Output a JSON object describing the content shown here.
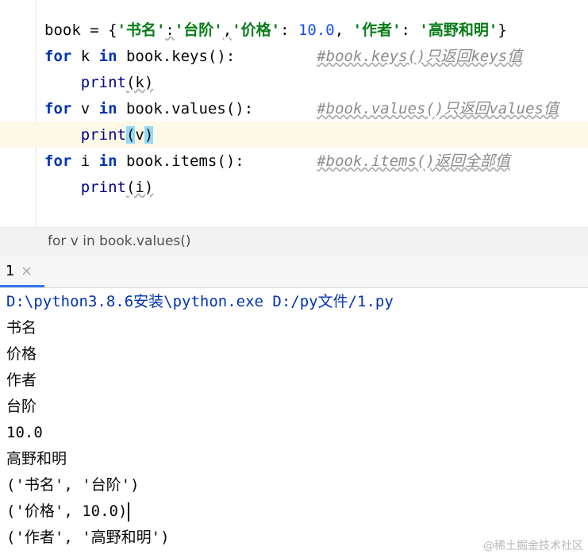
{
  "editor": {
    "line1": {
      "pre": "book = {",
      "k1": "'书名'",
      "sep1": ":",
      "v1": "'台阶'",
      "sep2": ",",
      "k2": "'价格'",
      "sep3": ": ",
      "v2": "10.0",
      "sep4": ", ",
      "k3": "'作者'",
      "sep5": ": ",
      "v3": "'高野和明'",
      "post": "}"
    },
    "line2": {
      "kw1": "for",
      "mid1": " k ",
      "kw2": "in",
      "mid2": " book.keys():         ",
      "comment": "#book.keys()只返回keys值"
    },
    "line3": {
      "fn": "print",
      "args": "(k)"
    },
    "line4": {
      "kw1": "for",
      "mid1": " v ",
      "kw2": "in",
      "mid2": " book.values():       ",
      "comment": "#book.values()只返回values值"
    },
    "line5": {
      "fn": "print",
      "lp": "(",
      "arg": "v",
      "rp": ")"
    },
    "line6": {
      "kw1": "for",
      "mid1": " i ",
      "kw2": "in",
      "mid2": " book.items():        ",
      "comment": "#book.items()返回全部值"
    },
    "line7": {
      "fn": "print",
      "args": "(i)"
    }
  },
  "breadcrumb": "for v in book.values()",
  "run_tab": {
    "label": "1",
    "close": "×"
  },
  "console": {
    "command": "D:\\python3.8.6安装\\python.exe D:/py文件/1.py",
    "lines": [
      "书名",
      "价格",
      "作者",
      "台阶",
      "10.0",
      "高野和明",
      "('书名', '台阶')",
      "('价格', 10.0)",
      "('作者', '高野和明')"
    ]
  },
  "watermark": "@稀土掘金技术社区"
}
